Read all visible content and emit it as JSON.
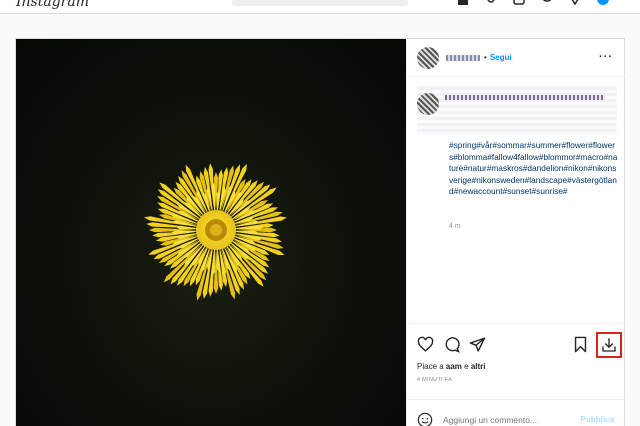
{
  "nav": {
    "logo": "Instagram",
    "icons": [
      "home-icon",
      "messenger-icon",
      "new-post-icon",
      "explore-icon",
      "heart-icon",
      "profile-avatar"
    ]
  },
  "post": {
    "header": {
      "separator": "•",
      "follow_label": "Segui",
      "more_label": "···"
    },
    "caption": {
      "hashtags": "#spring#vår#sommar#summer#flower#flowers#blomma#fallow4fallow#blommor#macro#nature#natur#maskros#dandelion#nikon#nikonsverige#nikonsweden#landscape#västergötland#newaccount#sunset#sunrise#",
      "time_ago": "4 m"
    },
    "actions": {
      "icons": [
        "heart-icon",
        "comment-icon",
        "share-icon",
        "bookmark-icon",
        "download-icon"
      ]
    },
    "likes": {
      "prefix": "Piace a ",
      "user": "aam",
      "middle": " e ",
      "others": "altri"
    },
    "timestamp": "4 MINUTI FA",
    "comment": {
      "placeholder": "Aggiungi un commento...",
      "publish_label": "Pubblica"
    }
  },
  "colors": {
    "link_blue": "#0095f6",
    "hashtag_blue": "#00376b",
    "highlight_red": "#e0201b",
    "flower_yellow": "#f2d21c"
  }
}
